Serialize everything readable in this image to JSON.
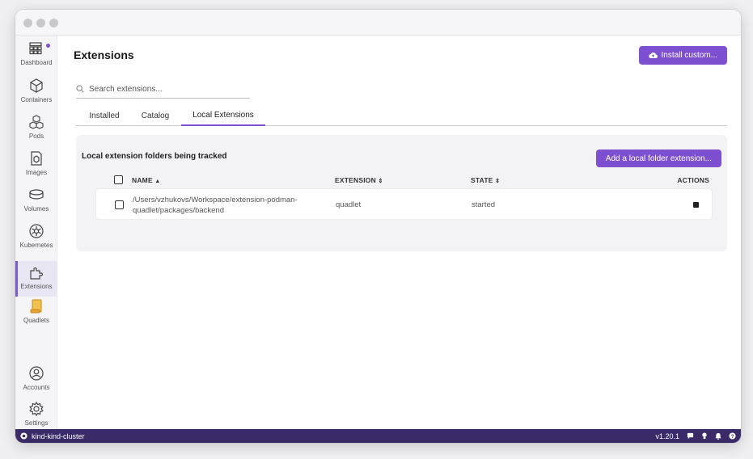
{
  "sidebar": {
    "items": [
      {
        "label": "Dashboard",
        "icon": "dashboard-icon"
      },
      {
        "label": "Containers",
        "icon": "containers-icon"
      },
      {
        "label": "Pods",
        "icon": "pods-icon"
      },
      {
        "label": "Images",
        "icon": "images-icon"
      },
      {
        "label": "Volumes",
        "icon": "volumes-icon"
      },
      {
        "label": "Kubernetes",
        "icon": "kubernetes-icon"
      },
      {
        "label": "Extensions",
        "icon": "extensions-icon"
      },
      {
        "label": "Quadlets",
        "icon": "quadlets-icon"
      }
    ],
    "bottom": [
      {
        "label": "Accounts",
        "icon": "accounts-icon"
      },
      {
        "label": "Settings",
        "icon": "settings-icon"
      }
    ]
  },
  "header": {
    "title": "Extensions",
    "install_button": "Install custom..."
  },
  "search": {
    "placeholder": "Search extensions..."
  },
  "tabs": [
    {
      "label": "Installed"
    },
    {
      "label": "Catalog"
    },
    {
      "label": "Local Extensions",
      "active": true
    }
  ],
  "panel": {
    "title": "Local extension folders being tracked",
    "add_button": "Add a local folder extension...",
    "columns": {
      "name": "NAME",
      "extension": "EXTENSION",
      "state": "STATE",
      "actions": "ACTIONS"
    },
    "rows": [
      {
        "path_line1": "/Users/vzhukovs/Workspace/extension-podman-",
        "path_line2": "quadlet/packages/backend",
        "extension": "quadlet",
        "state": "started"
      }
    ]
  },
  "statusbar": {
    "context": "kind-kind-cluster",
    "version": "v1.20.1"
  },
  "colors": {
    "accent": "#7d4fd1",
    "statusbar": "#3a2b68"
  }
}
